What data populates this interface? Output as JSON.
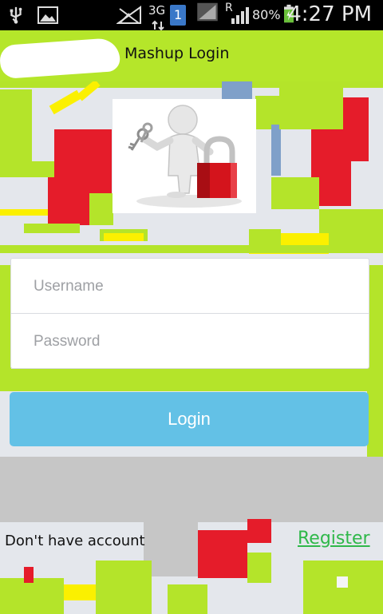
{
  "status_bar": {
    "network_type": "3G",
    "sim_slot": "1",
    "roaming_indicator": "R",
    "battery_percent": "80%",
    "time": "4:27 PM",
    "icons": [
      "usb-icon",
      "gallery-icon",
      "no-signal-icon",
      "data-arrows-icon",
      "sim-icon",
      "signal-icon",
      "roaming-signal-icon",
      "battery-charging-icon"
    ]
  },
  "header": {
    "title": "Mashup Login"
  },
  "logo": {
    "icon": "person-with-keys-and-padlock-icon"
  },
  "form": {
    "username_placeholder": "Username",
    "password_placeholder": "Password"
  },
  "actions": {
    "login_label": "Login",
    "no_account_text": "Don't have account",
    "register_label": "Register"
  },
  "colors": {
    "header": "#b5e62a",
    "login_button": "#63c1e6",
    "register_link": "#2fb84a"
  }
}
